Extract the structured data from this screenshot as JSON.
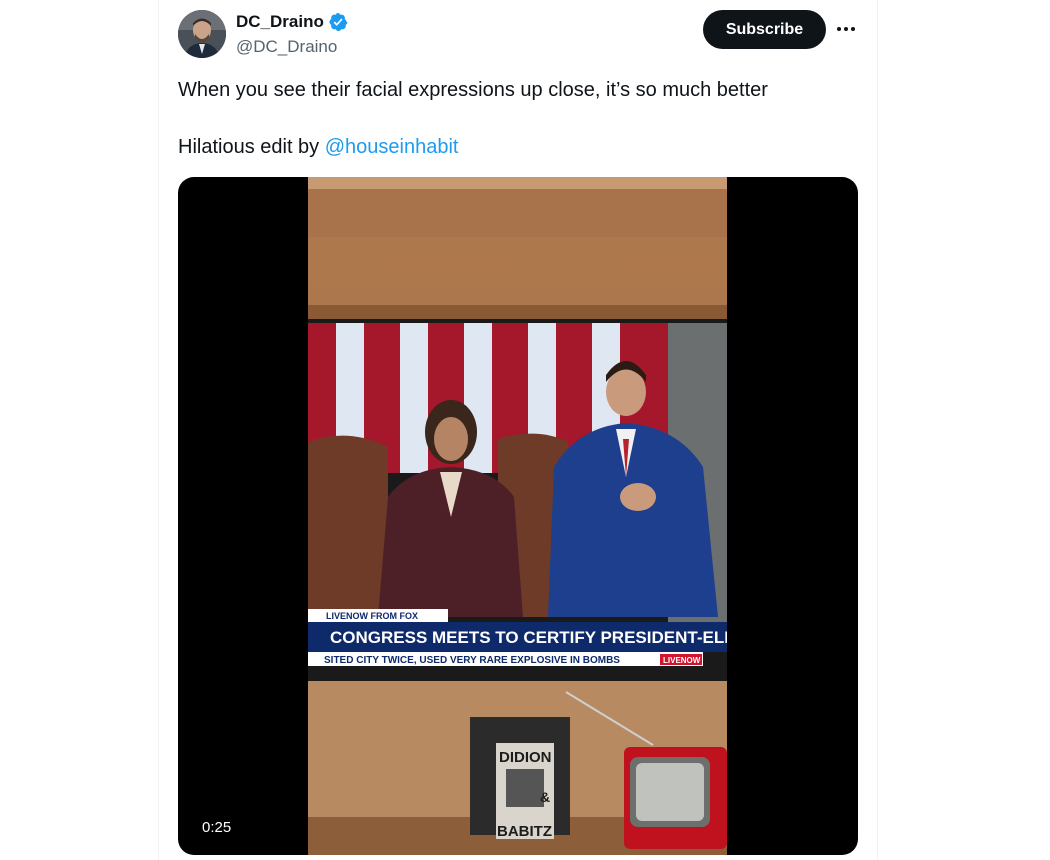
{
  "tweet": {
    "display_name": "DC_Draino",
    "handle": "@DC_Draino",
    "verified": true,
    "subscribe_label": "Subscribe",
    "text_line1": "When you see their facial expressions up close, it’s so much better",
    "text_line2_prefix": "Hilatious edit by ",
    "mention": "@houseinhabit"
  },
  "video": {
    "duration": "0:25",
    "chyron_label": "LIVENOW FROM FOX",
    "chyron_headline": "CONGRESS MEETS TO CERTIFY PRESIDENT-ELECT T",
    "chyron_ticker": "SITED CITY TWICE, USED VERY RARE EXPLOSIVE IN BOMBS",
    "chyron_logo": "LIVENOW",
    "book_title_top": "DIDION",
    "book_amp": "&",
    "book_title_bottom": "BABITZ"
  },
  "colors": {
    "accent": "#1d9bf0",
    "button_bg": "#0f1419",
    "secondary_text": "#536471"
  },
  "icons": [
    "avatar",
    "verified-badge-icon",
    "more-options-icon"
  ]
}
